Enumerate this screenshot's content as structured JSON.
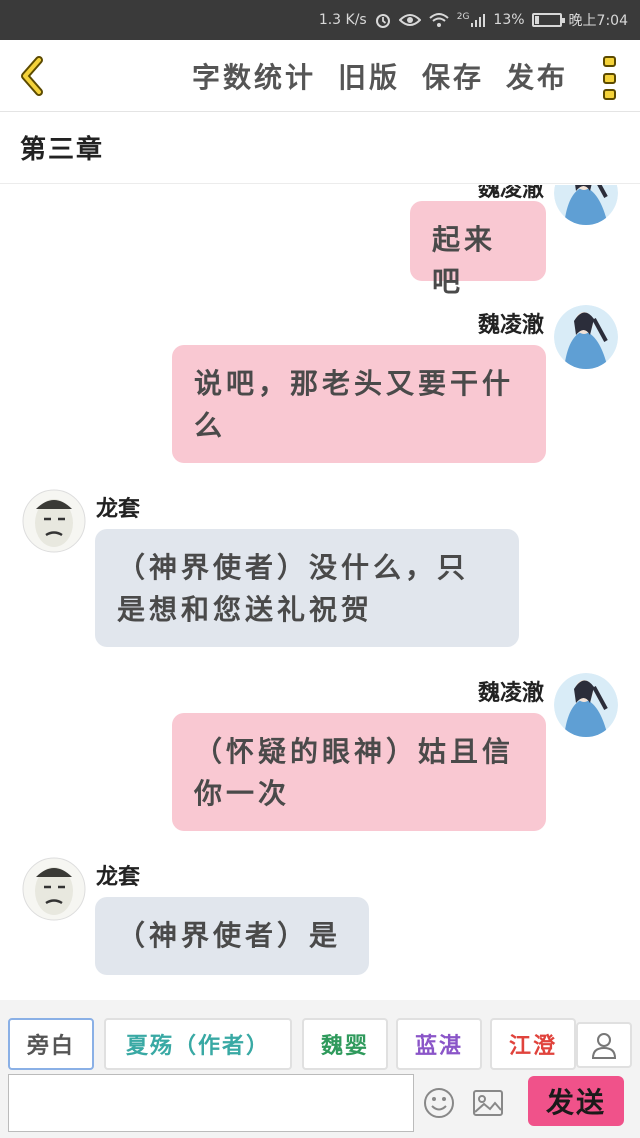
{
  "status_bar": {
    "net_speed": "1.3 K/s",
    "network_type": "2G",
    "battery_pct": "13%",
    "time": "晚上7:04",
    "icons": [
      "alarm-icon",
      "eye-icon",
      "wifi-icon",
      "signal-icon",
      "battery-icon"
    ]
  },
  "toolbar": {
    "back_icon": "chevron-left-icon",
    "word_count_label": "字数统计",
    "old_version_label": "旧版",
    "save_label": "保存",
    "publish_label": "发布",
    "menu_icon": "more-vertical-icon"
  },
  "chapter": {
    "title": "第三章"
  },
  "messages": [
    {
      "sender": "魏凌澈",
      "side": "right",
      "text": "起来吧",
      "partially_visible": true
    },
    {
      "sender": "魏凌澈",
      "side": "right",
      "text": "说吧，那老头又要干什么"
    },
    {
      "sender": "龙套",
      "side": "left",
      "text": "（神界使者）没什么，只是想和您送礼祝贺"
    },
    {
      "sender": "魏凌澈",
      "side": "right",
      "text": "（怀疑的眼神）姑且信你一次"
    },
    {
      "sender": "龙套",
      "side": "left",
      "text": "（神界使者）是"
    }
  ],
  "roles": [
    {
      "label": "旁白",
      "color": "#555555",
      "active": true
    },
    {
      "label": "夏殇（作者）",
      "color": "#39a9a4",
      "active": false
    },
    {
      "label": "魏婴",
      "color": "#2f9a5c",
      "active": false
    },
    {
      "label": "蓝湛",
      "color": "#8a55c8",
      "active": false
    },
    {
      "label": "江澄",
      "color": "#e0433c",
      "active": false
    }
  ],
  "role_bar": {
    "user_icon": "user-icon"
  },
  "input": {
    "value": "",
    "placeholder": "",
    "emoji_icon": "smiley-icon",
    "image_icon": "image-icon",
    "send_label": "发送",
    "send_color": "#f0528a"
  },
  "colors": {
    "bubble_right": "#f9c8d2",
    "bubble_left": "#e1e6ed",
    "accent": "#f4d23a"
  }
}
